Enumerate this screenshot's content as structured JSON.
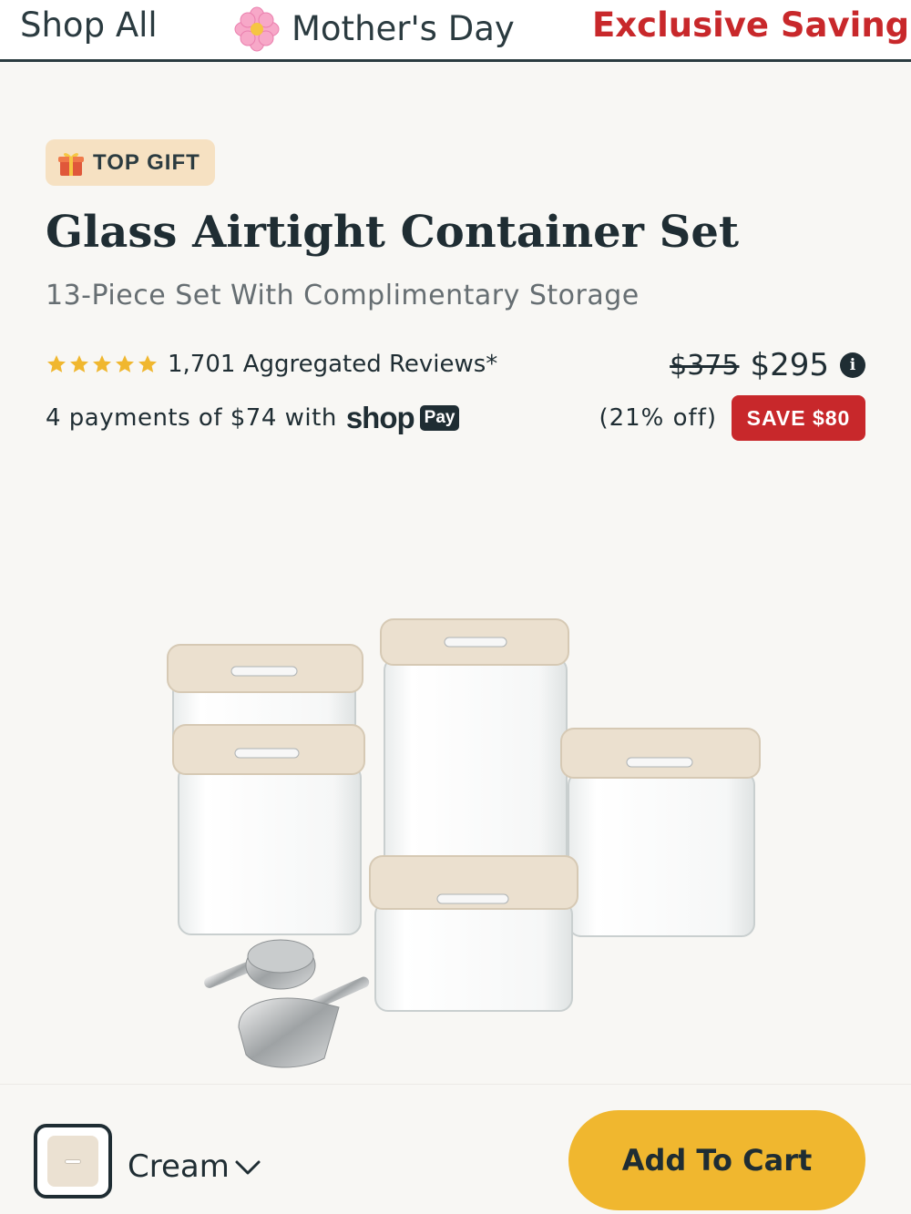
{
  "nav": {
    "shop_all": "Shop All",
    "mothers_day": "Mother's Day",
    "exclusive_savings": "Exclusive Savings",
    "mothers_day_icon": "flower-icon",
    "exclusive_color": "#c8282b"
  },
  "product": {
    "badge": "TOP GIFT",
    "badge_icon": "gift-icon",
    "title": "Glass Airtight Container Set",
    "subtitle": "13-Piece Set With Complimentary Storage",
    "rating_stars": 5,
    "reviews": "1,701 Aggregated Reviews*",
    "payments_text": "4 payments of $74 with",
    "shop_logo": "shop",
    "pay_label": "Pay",
    "price_old": "$375",
    "price_new": "$295",
    "discount_pct": "(21% off)",
    "save_label": "SAVE $80"
  },
  "bottom": {
    "color_name": "Cream",
    "add_to_cart": "Add To Cart",
    "accent": "#f0b72f"
  }
}
